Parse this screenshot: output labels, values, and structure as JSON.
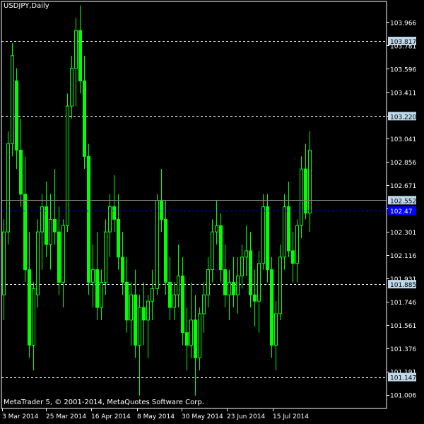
{
  "chart_title": "USDJPY,Daily",
  "copyright": "MetaTrader 5, © 2001-2014, MetaQuotes Software Corp.",
  "colors": {
    "background": "#000000",
    "candle": "#00ff00",
    "frame": "#ffffff",
    "text": "#ffffff",
    "level_line": "#ffffff",
    "level_label_bg": "#bfd9ea",
    "current_price_line": "#8a8a8a",
    "current_price_label_bg": "#bfd9ea",
    "ask_line": "#0000ff",
    "ask_label_bg": "#0000ff"
  },
  "chart_data": {
    "type": "candlestick",
    "symbol": "USDJPY",
    "timeframe": "Daily",
    "ylim": [
      100.92,
      104.12
    ],
    "price_ticks": [
      "103.966",
      "103.781",
      "103.596",
      "103.411",
      "103.220",
      "103.041",
      "102.856",
      "102.671",
      "102.486",
      "102.301",
      "102.116",
      "101.931",
      "101.746",
      "101.561",
      "101.376",
      "101.191",
      "101.006"
    ],
    "date_ticks": [
      "3 Mar 2014",
      "25 Mar 2014",
      "16 Apr 2014",
      "8 May 2014",
      "30 May 2014",
      "23 Jun 2014",
      "15 Jul 2014"
    ],
    "level_lines": [
      103.817,
      103.22,
      101.885,
      101.147
    ],
    "current_price": 102.552,
    "ask_price": 102.47,
    "ask_label": "102.47",
    "candles": [
      [
        101.8,
        102.4,
        101.6,
        102.3
      ],
      [
        102.3,
        103.1,
        102.2,
        103.0
      ],
      [
        103.0,
        103.8,
        102.9,
        103.7
      ],
      [
        103.5,
        103.6,
        102.8,
        102.95
      ],
      [
        102.95,
        103.2,
        102.5,
        102.6
      ],
      [
        102.6,
        102.9,
        101.9,
        102.0
      ],
      [
        102.0,
        102.3,
        101.3,
        101.4
      ],
      [
        101.4,
        101.9,
        101.2,
        101.85
      ],
      [
        101.8,
        102.4,
        101.7,
        102.3
      ],
      [
        102.3,
        102.6,
        102.0,
        102.5
      ],
      [
        102.5,
        102.7,
        102.1,
        102.2
      ],
      [
        102.2,
        102.6,
        102.0,
        102.4
      ],
      [
        102.4,
        102.8,
        102.2,
        102.3
      ],
      [
        102.3,
        102.5,
        101.8,
        101.9
      ],
      [
        101.9,
        102.4,
        101.7,
        102.35
      ],
      [
        102.35,
        103.4,
        102.3,
        103.3
      ],
      [
        103.3,
        103.7,
        103.2,
        103.6
      ],
      [
        103.6,
        104.0,
        103.3,
        103.9
      ],
      [
        103.9,
        104.1,
        103.4,
        103.5
      ],
      [
        103.5,
        103.7,
        102.8,
        102.9
      ],
      [
        102.9,
        103.0,
        101.8,
        101.9
      ],
      [
        101.9,
        102.2,
        101.7,
        102.0
      ],
      [
        102.0,
        102.3,
        101.6,
        101.7
      ],
      [
        101.7,
        102.0,
        101.6,
        101.9
      ],
      [
        101.9,
        102.4,
        101.8,
        102.3
      ],
      [
        102.3,
        102.6,
        102.1,
        102.5
      ],
      [
        102.5,
        102.75,
        102.3,
        102.4
      ],
      [
        102.4,
        102.6,
        102.0,
        102.1
      ],
      [
        102.1,
        102.3,
        101.8,
        101.9
      ],
      [
        101.9,
        102.1,
        101.5,
        101.6
      ],
      [
        101.6,
        101.9,
        101.4,
        101.8
      ],
      [
        101.8,
        102.0,
        101.3,
        101.4
      ],
      [
        101.4,
        101.8,
        101.0,
        101.7
      ],
      [
        101.7,
        101.9,
        101.4,
        101.6
      ],
      [
        101.6,
        101.8,
        101.3,
        101.75
      ],
      [
        101.75,
        102.0,
        101.6,
        101.85
      ],
      [
        101.85,
        102.6,
        101.8,
        102.55
      ],
      [
        102.55,
        102.8,
        102.3,
        102.4
      ],
      [
        102.4,
        102.55,
        101.8,
        101.9
      ],
      [
        101.9,
        102.1,
        101.6,
        101.7
      ],
      [
        101.7,
        101.9,
        101.6,
        101.8
      ],
      [
        101.8,
        102.2,
        101.7,
        101.95
      ],
      [
        101.95,
        102.1,
        101.4,
        101.5
      ],
      [
        101.5,
        101.7,
        101.2,
        101.4
      ],
      [
        101.4,
        101.9,
        101.3,
        101.6
      ],
      [
        101.6,
        101.8,
        101.0,
        101.3
      ],
      [
        101.3,
        101.7,
        101.2,
        101.65
      ],
      [
        101.65,
        101.9,
        101.5,
        101.8
      ],
      [
        101.8,
        102.1,
        101.7,
        102.0
      ],
      [
        102.0,
        102.4,
        101.9,
        102.3
      ],
      [
        102.3,
        102.55,
        102.2,
        102.35
      ],
      [
        102.35,
        102.45,
        101.9,
        102.0
      ],
      [
        102.0,
        102.2,
        101.7,
        101.8
      ],
      [
        101.8,
        102.0,
        101.6,
        101.9
      ],
      [
        101.9,
        102.1,
        101.7,
        101.8
      ],
      [
        101.8,
        102.1,
        101.65,
        101.95
      ],
      [
        101.95,
        102.2,
        101.85,
        102.1
      ],
      [
        102.1,
        102.35,
        101.95,
        102.15
      ],
      [
        102.15,
        102.3,
        101.7,
        101.8
      ],
      [
        101.8,
        102.0,
        101.55,
        101.75
      ],
      [
        101.75,
        102.15,
        101.5,
        102.05
      ],
      [
        102.05,
        102.6,
        102.0,
        102.5
      ],
      [
        102.5,
        102.6,
        101.9,
        102.0
      ],
      [
        102.0,
        102.1,
        101.3,
        101.4
      ],
      [
        101.4,
        101.75,
        101.2,
        101.65
      ],
      [
        101.65,
        102.2,
        101.6,
        102.1
      ],
      [
        102.1,
        102.6,
        102.0,
        102.5
      ],
      [
        102.5,
        102.7,
        102.1,
        102.15
      ],
      [
        102.15,
        102.3,
        101.9,
        102.05
      ],
      [
        102.05,
        102.4,
        101.9,
        102.35
      ],
      [
        102.35,
        102.9,
        102.25,
        102.8
      ],
      [
        102.8,
        103.0,
        102.4,
        102.45
      ],
      [
        102.45,
        103.1,
        102.3,
        102.95
      ]
    ]
  }
}
